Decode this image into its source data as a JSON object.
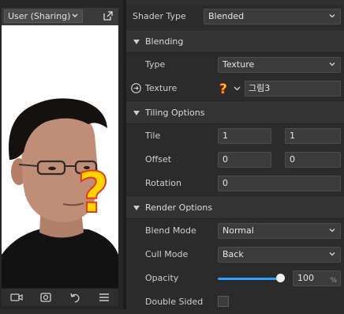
{
  "preview": {
    "user_select": "User (Sharing)",
    "icons": [
      "popout-icon",
      "camera-icon",
      "camera-switch-icon",
      "undo-icon",
      "menu-icon"
    ]
  },
  "properties": {
    "shader_type": {
      "label": "Shader Type",
      "value": "Blended"
    },
    "blending": {
      "title": "Blending",
      "type": {
        "label": "Type",
        "value": "Texture"
      },
      "texture": {
        "label": "Texture",
        "value": "그림3"
      }
    },
    "tiling": {
      "title": "Tiling Options",
      "tile": {
        "label": "Tile",
        "x": "1",
        "y": "1"
      },
      "offset": {
        "label": "Offset",
        "x": "0",
        "y": "0"
      },
      "rotation": {
        "label": "Rotation",
        "value": "0"
      }
    },
    "render": {
      "title": "Render Options",
      "blend_mode": {
        "label": "Blend Mode",
        "value": "Normal"
      },
      "cull_mode": {
        "label": "Cull Mode",
        "value": "Back"
      },
      "opacity": {
        "label": "Opacity",
        "value": "100",
        "unit": "%",
        "level": 1.0
      },
      "double_sided": {
        "label": "Double Sided",
        "checked": false
      }
    }
  },
  "colors": {
    "accent": "#2ea0ff",
    "question": "#ffd400"
  }
}
